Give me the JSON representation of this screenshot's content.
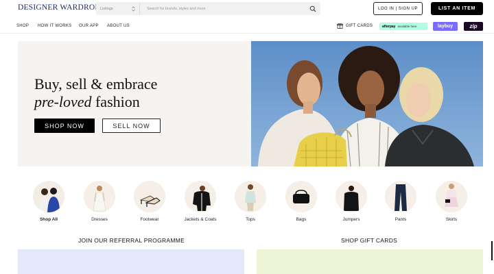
{
  "header": {
    "logo": "DESIGNER WARDROBE",
    "search_category": "Listings",
    "search_placeholder": "Search for brands, styles and more",
    "login_label": "LOG IN | SIGN UP",
    "list_item_label": "LIST AN ITEM"
  },
  "nav": {
    "items": [
      {
        "label": "SHOP"
      },
      {
        "label": "HOW IT WORKS"
      },
      {
        "label": "OUR APP"
      },
      {
        "label": "ABOUT US"
      }
    ],
    "gift_cards": "GIFT CARDS",
    "afterpay_logo": "afterpay",
    "afterpay_text": "available here",
    "laybuy": "laybuy",
    "zip": "zip"
  },
  "hero": {
    "title_line1": "Buy, sell & embrace",
    "title_italic": "pre-loved",
    "title_rest": " fashion",
    "shop_now": "SHOP NOW",
    "sell_now": "SELL NOW"
  },
  "categories": [
    {
      "label": "Shop All",
      "bold": true,
      "icon": "two-people-icon"
    },
    {
      "label": "Dresses",
      "icon": "dress-icon"
    },
    {
      "label": "Footwear",
      "icon": "heels-icon"
    },
    {
      "label": "Jackets & Coats",
      "icon": "jacket-icon"
    },
    {
      "label": "Tops",
      "icon": "top-icon"
    },
    {
      "label": "Bags",
      "icon": "bag-icon"
    },
    {
      "label": "Jumpers",
      "icon": "jumper-icon"
    },
    {
      "label": "Pants",
      "icon": "pants-icon"
    },
    {
      "label": "Skirts",
      "icon": "skirt-icon"
    }
  ],
  "sections": {
    "referral_title": "JOIN OUR REFERRAL PROGRAMME",
    "gift_title": "SHOP GIFT CARDS"
  },
  "colors": {
    "brand": "#1b2a6b",
    "afterpay": "#b2fce4",
    "laybuy": "#786dff",
    "zip": "#1a0826",
    "referral_panel": "#e3e8fb",
    "gift_panel": "#eef5d6"
  }
}
